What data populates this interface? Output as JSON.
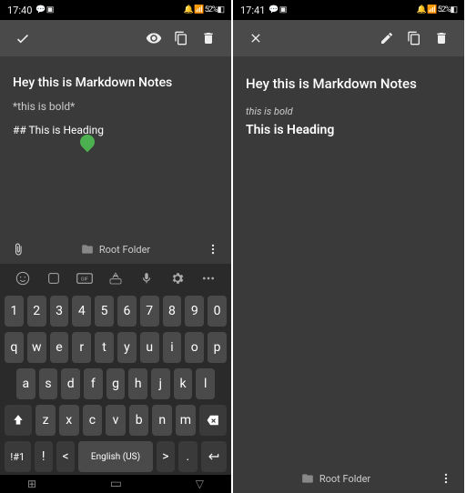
{
  "status": {
    "time_left": "17:40",
    "time_right": "17:41",
    "icons_left": "💬 ▣",
    "icons_right": "🔔 📶 52%◧"
  },
  "editor": {
    "line1": "Hey this is Markdown Notes",
    "line2": "*this is bold*",
    "line3": "## This is Heading"
  },
  "preview": {
    "title": "Hey this is Markdown Notes",
    "bold_line": "this is bold",
    "heading": "This is Heading"
  },
  "footer": {
    "folder": "Root Folder"
  },
  "keyboard": {
    "row1": [
      "1",
      "2",
      "3",
      "4",
      "5",
      "6",
      "7",
      "8",
      "9",
      "0"
    ],
    "row2": [
      "q",
      "w",
      "e",
      "r",
      "t",
      "y",
      "u",
      "i",
      "o",
      "p"
    ],
    "row3": [
      "a",
      "s",
      "d",
      "f",
      "g",
      "h",
      "j",
      "k",
      "l"
    ],
    "row4": [
      "z",
      "x",
      "c",
      "v",
      "b",
      "n",
      "m"
    ],
    "sym_key": "!#1",
    "lang": "English (US)"
  }
}
